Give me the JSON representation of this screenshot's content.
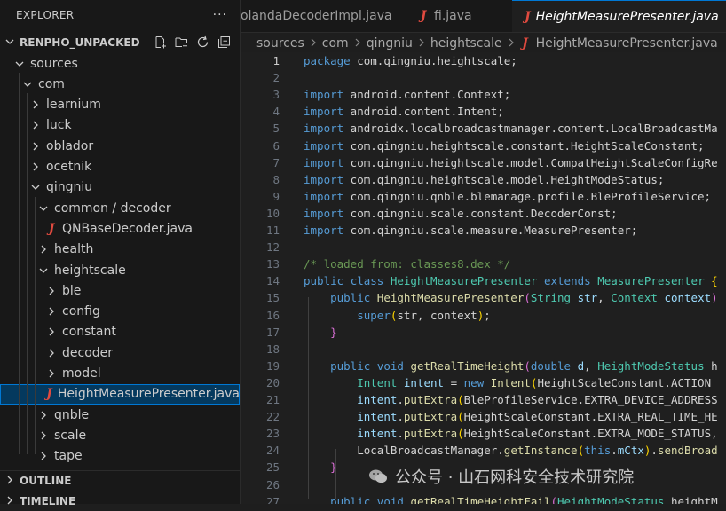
{
  "explorer": {
    "title": "EXPLORER",
    "more": "···",
    "root": "RENPHO_UNPACKED",
    "items": [
      {
        "label": "sources",
        "depth": 0,
        "kind": "open"
      },
      {
        "label": "com",
        "depth": 1,
        "kind": "open"
      },
      {
        "label": "learnium",
        "depth": 2,
        "kind": "closed"
      },
      {
        "label": "luck",
        "depth": 2,
        "kind": "closed"
      },
      {
        "label": "oblador",
        "depth": 2,
        "kind": "closed"
      },
      {
        "label": "ocetnik",
        "depth": 2,
        "kind": "closed"
      },
      {
        "label": "qingniu",
        "depth": 2,
        "kind": "open"
      },
      {
        "label": "common / decoder",
        "depth": 3,
        "kind": "open"
      },
      {
        "label": "QNBaseDecoder.java",
        "depth": 4,
        "kind": "java"
      },
      {
        "label": "health",
        "depth": 3,
        "kind": "closed"
      },
      {
        "label": "heightscale",
        "depth": 3,
        "kind": "open"
      },
      {
        "label": "ble",
        "depth": 4,
        "kind": "closed"
      },
      {
        "label": "config",
        "depth": 4,
        "kind": "closed"
      },
      {
        "label": "constant",
        "depth": 4,
        "kind": "closed"
      },
      {
        "label": "decoder",
        "depth": 4,
        "kind": "closed"
      },
      {
        "label": "model",
        "depth": 4,
        "kind": "closed"
      },
      {
        "label": "HeightMeasurePresenter.java",
        "depth": 4,
        "kind": "java",
        "selected": true
      },
      {
        "label": "qnble",
        "depth": 3,
        "kind": "closed"
      },
      {
        "label": "scale",
        "depth": 3,
        "kind": "closed"
      },
      {
        "label": "tape",
        "depth": 3,
        "kind": "closed"
      }
    ],
    "outline": "OUTLINE",
    "timeline": "TIMELINE"
  },
  "tabs": [
    {
      "label": "olandaDecoderImpl.java",
      "icon": "",
      "active": false
    },
    {
      "label": "fi.java",
      "icon": "J",
      "active": false
    },
    {
      "label": "HeightMeasurePresenter.java",
      "icon": "J",
      "active": true,
      "close": "✕"
    }
  ],
  "breadcrumb": [
    "sources",
    "com",
    "qingniu",
    "heightscale",
    "HeightMeasurePresenter.java"
  ],
  "code": {
    "current_line": 1,
    "lines": [
      {
        "n": "1",
        "tokens": [
          [
            "k",
            "package"
          ],
          [
            "pl",
            " com.qingniu.heightscale;"
          ]
        ]
      },
      {
        "n": "2",
        "tokens": []
      },
      {
        "n": "3",
        "tokens": [
          [
            "k",
            "import"
          ],
          [
            "pl",
            " android.content.Context;"
          ]
        ]
      },
      {
        "n": "4",
        "tokens": [
          [
            "k",
            "import"
          ],
          [
            "pl",
            " android.content.Intent;"
          ]
        ]
      },
      {
        "n": "5",
        "tokens": [
          [
            "k",
            "import"
          ],
          [
            "pl",
            " androidx.localbroadcastmanager.content.LocalBroadcastMa"
          ]
        ]
      },
      {
        "n": "6",
        "tokens": [
          [
            "k",
            "import"
          ],
          [
            "pl",
            " com.qingniu.heightscale.constant.HeightScaleConstant;"
          ]
        ]
      },
      {
        "n": "7",
        "tokens": [
          [
            "k",
            "import"
          ],
          [
            "pl",
            " com.qingniu.heightscale.model.CompatHeightScaleConfigRe"
          ]
        ]
      },
      {
        "n": "8",
        "tokens": [
          [
            "k",
            "import"
          ],
          [
            "pl",
            " com.qingniu.heightscale.model.HeightModeStatus;"
          ]
        ]
      },
      {
        "n": "9",
        "tokens": [
          [
            "k",
            "import"
          ],
          [
            "pl",
            " com.qingniu.qnble.blemanage.profile.BleProfileService;"
          ]
        ]
      },
      {
        "n": "10",
        "tokens": [
          [
            "k",
            "import"
          ],
          [
            "pl",
            " com.qingniu.scale.constant.DecoderConst;"
          ]
        ]
      },
      {
        "n": "11",
        "tokens": [
          [
            "k",
            "import"
          ],
          [
            "pl",
            " com.qingniu.scale.measure.MeasurePresenter;"
          ]
        ]
      },
      {
        "n": "12",
        "tokens": []
      },
      {
        "n": "13",
        "tokens": [
          [
            "c",
            "/* loaded from: classes8.dex */"
          ]
        ]
      },
      {
        "n": "14",
        "tokens": [
          [
            "k",
            "public"
          ],
          [
            "pl",
            " "
          ],
          [
            "k",
            "class"
          ],
          [
            "pl",
            " "
          ],
          [
            "t",
            "HeightMeasurePresenter"
          ],
          [
            "pl",
            " "
          ],
          [
            "k",
            "extends"
          ],
          [
            "pl",
            " "
          ],
          [
            "t",
            "MeasurePresenter"
          ],
          [
            "pl",
            " "
          ],
          [
            "by",
            "{"
          ]
        ]
      },
      {
        "n": "15",
        "tokens": [
          [
            "pl",
            "    "
          ],
          [
            "k",
            "public"
          ],
          [
            "pl",
            " "
          ],
          [
            "f",
            "HeightMeasurePresenter"
          ],
          [
            "br",
            "("
          ],
          [
            "t",
            "String"
          ],
          [
            "pl",
            " "
          ],
          [
            "v",
            "str"
          ],
          [
            "pl",
            ", "
          ],
          [
            "t",
            "Context"
          ],
          [
            "pl",
            " "
          ],
          [
            "v",
            "context"
          ],
          [
            "br",
            ")"
          ]
        ]
      },
      {
        "n": "16",
        "tokens": [
          [
            "pl",
            "        "
          ],
          [
            "k",
            "super"
          ],
          [
            "by",
            "("
          ],
          [
            "pl",
            "str, context"
          ],
          [
            "by",
            ")"
          ],
          [
            "pl",
            ";"
          ]
        ]
      },
      {
        "n": "17",
        "tokens": [
          [
            "pl",
            "    "
          ],
          [
            "br",
            "}"
          ]
        ]
      },
      {
        "n": "18",
        "tokens": []
      },
      {
        "n": "19",
        "tokens": [
          [
            "pl",
            "    "
          ],
          [
            "k",
            "public"
          ],
          [
            "pl",
            " "
          ],
          [
            "k",
            "void"
          ],
          [
            "pl",
            " "
          ],
          [
            "f",
            "getRealTimeHeight"
          ],
          [
            "br",
            "("
          ],
          [
            "k",
            "double"
          ],
          [
            "pl",
            " "
          ],
          [
            "v",
            "d"
          ],
          [
            "pl",
            ", "
          ],
          [
            "t",
            "HeightModeStatus"
          ],
          [
            "pl",
            " h"
          ]
        ]
      },
      {
        "n": "20",
        "tokens": [
          [
            "pl",
            "        "
          ],
          [
            "t",
            "Intent"
          ],
          [
            "pl",
            " "
          ],
          [
            "v",
            "intent"
          ],
          [
            "pl",
            " = "
          ],
          [
            "k",
            "new"
          ],
          [
            "pl",
            " "
          ],
          [
            "f",
            "Intent"
          ],
          [
            "by",
            "("
          ],
          [
            "pl",
            "HeightScaleConstant.ACTION_"
          ]
        ]
      },
      {
        "n": "21",
        "tokens": [
          [
            "pl",
            "        "
          ],
          [
            "v",
            "intent"
          ],
          [
            "pl",
            "."
          ],
          [
            "f",
            "putExtra"
          ],
          [
            "by",
            "("
          ],
          [
            "pl",
            "BleProfileService.EXTRA_DEVICE_ADDRESS"
          ]
        ]
      },
      {
        "n": "22",
        "tokens": [
          [
            "pl",
            "        "
          ],
          [
            "v",
            "intent"
          ],
          [
            "pl",
            "."
          ],
          [
            "f",
            "putExtra"
          ],
          [
            "by",
            "("
          ],
          [
            "pl",
            "HeightScaleConstant.EXTRA_REAL_TIME_HE"
          ]
        ]
      },
      {
        "n": "23",
        "tokens": [
          [
            "pl",
            "        "
          ],
          [
            "v",
            "intent"
          ],
          [
            "pl",
            "."
          ],
          [
            "f",
            "putExtra"
          ],
          [
            "by",
            "("
          ],
          [
            "pl",
            "HeightScaleConstant.EXTRA_MODE_STATUS,"
          ]
        ]
      },
      {
        "n": "24",
        "tokens": [
          [
            "pl",
            "        "
          ],
          [
            "pl",
            "LocalBroadcastManager."
          ],
          [
            "f",
            "getInstance"
          ],
          [
            "by",
            "("
          ],
          [
            "k",
            "this"
          ],
          [
            "pl",
            "."
          ],
          [
            "v",
            "mCtx"
          ],
          [
            "by",
            ")"
          ],
          [
            "pl",
            "."
          ],
          [
            "f",
            "sendBroad"
          ]
        ]
      },
      {
        "n": "25",
        "tokens": [
          [
            "pl",
            "    "
          ],
          [
            "br",
            "}"
          ]
        ]
      },
      {
        "n": "26",
        "tokens": []
      },
      {
        "n": "27",
        "tokens": [
          [
            "pl",
            "    "
          ],
          [
            "k",
            "public"
          ],
          [
            "pl",
            " "
          ],
          [
            "k",
            "void"
          ],
          [
            "pl",
            " "
          ],
          [
            "f",
            "getRealTimeHeightFail"
          ],
          [
            "br",
            "("
          ],
          [
            "t",
            "HeightModeStatus"
          ],
          [
            "pl",
            " heightM"
          ]
        ]
      }
    ]
  },
  "watermark": {
    "text": "公众号 · 山石网科安全技术研究院",
    "icon": "wechat-icon"
  },
  "colors": {
    "accent": "#0078d4",
    "java_icon": "#e04a3f",
    "keyword": "#569cd6",
    "type": "#4ec9b0",
    "function": "#dcdcaa",
    "comment": "#6a9955"
  }
}
